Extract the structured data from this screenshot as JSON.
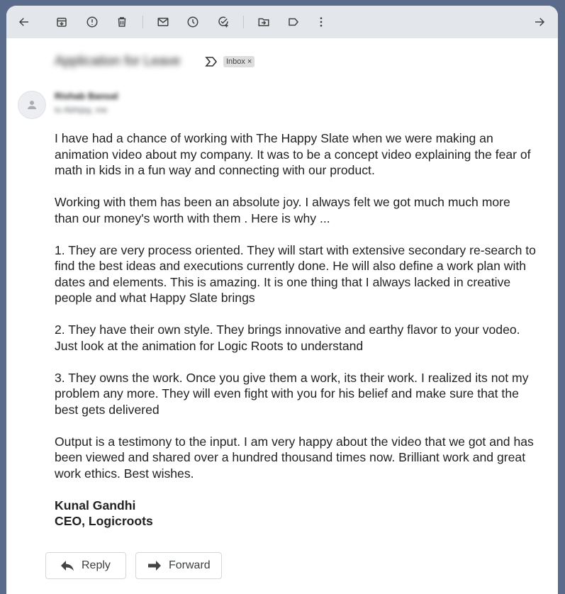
{
  "toolbar": {
    "icons": [
      "back-arrow-icon",
      "archive-icon",
      "report-spam-icon",
      "delete-icon",
      "mark-unread-icon",
      "snooze-icon",
      "add-task-icon",
      "move-to-icon",
      "label-icon",
      "more-options-icon",
      "forward-arrow-icon"
    ]
  },
  "email": {
    "subject": "Application for Leave",
    "label": "Inbox",
    "label_remove": "×",
    "sender": "Rishab Bansal",
    "recipient": "to Abhijay, me",
    "paragraphs": [
      "I have had a chance of working with The Happy Slate when we were making an animation video about my company. It was to be a concept video explaining the fear of math in kids in a fun way and connecting with our product.",
      "Working with them has been an absolute joy. I always felt we got much much more than our money's worth with them . Here is why ...",
      "1. They are very process oriented. They will start with extensive secondary re-search to find the best ideas and executions currently done. He will also define a work plan with dates and elements. This is amazing. It is one thing that I always lacked in creative people and what Happy Slate brings",
      "2. They have their own style. They brings innovative and earthy flavor to your vodeo. Just look at the animation for Logic Roots to understand",
      "3. They owns the work. Once you give them a work, its their work. I realized its not my problem any more. They will even fight with you for his belief and make sure that the best gets delivered",
      "Output is a testimony to the input. I am very happy about the video that we got and has been viewed and shared over a hundred thousand times now. Brilliant work and great work ethics. Best wishes."
    ],
    "signature_name": "Kunal Gandhi",
    "signature_title": "CEO, Logicroots"
  },
  "actions": {
    "reply": "Reply",
    "forward": "Forward"
  }
}
